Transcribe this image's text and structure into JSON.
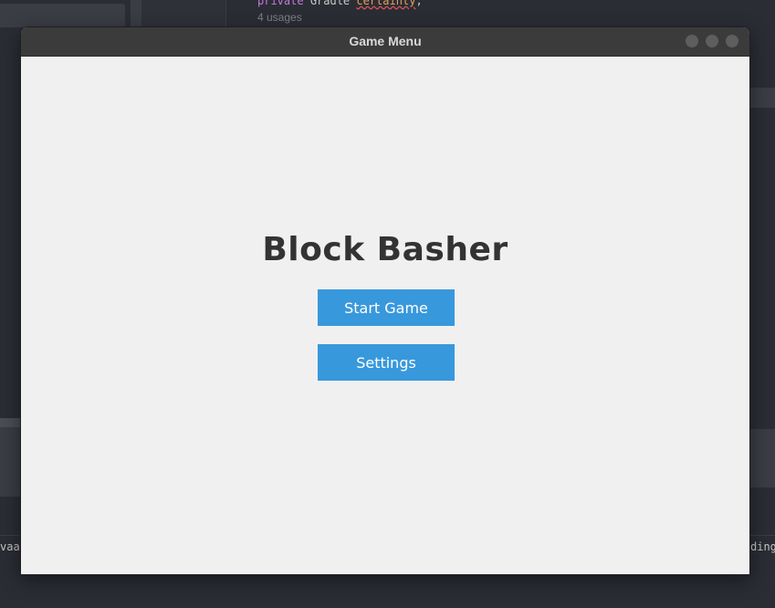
{
  "background_ide": {
    "code_line_keyword": "private",
    "code_line_type": "Gradle",
    "code_line_ident": "certainty",
    "usages": "4 usages",
    "bottom_left_fragment": "vaa",
    "bottom_right_fragment": "ding"
  },
  "window": {
    "title": "Game Menu"
  },
  "menu": {
    "game_title": "Block Basher",
    "start_label": "Start Game",
    "settings_label": "Settings"
  },
  "colors": {
    "button_bg": "#3898dc",
    "content_bg": "#f0f0f0",
    "titlebar_bg": "#3b3b3b",
    "title_text": "#333333"
  },
  "icons": {
    "window_controls": [
      "minimize-icon",
      "maximize-icon",
      "close-icon"
    ]
  }
}
